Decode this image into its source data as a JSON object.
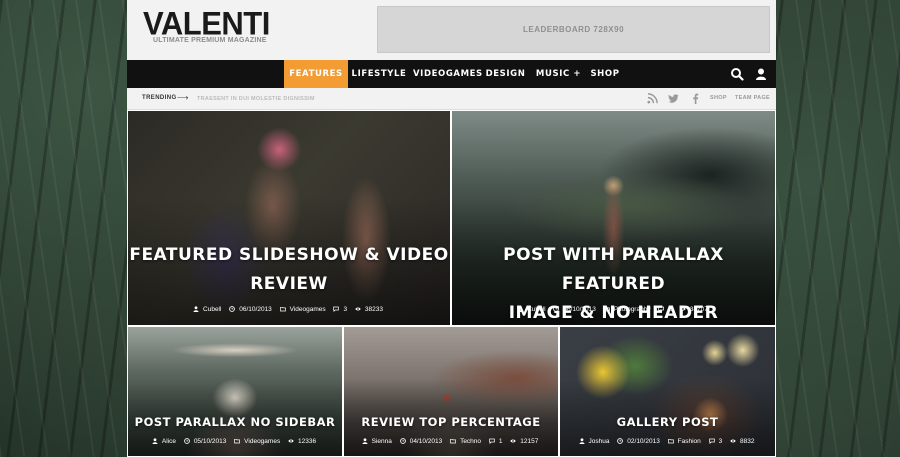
{
  "brand": {
    "logo": "VALENTI",
    "tagline": "ULTIMATE PREMIUM MAGAZINE",
    "leaderboard": "LEADERBOARD 728X90"
  },
  "nav": {
    "items": [
      {
        "label": "FEATURES +",
        "active": true
      },
      {
        "label": "LIFESTYLE +",
        "active": false
      },
      {
        "label": "VIDEOGAMES",
        "active": false
      },
      {
        "label": "DESIGN +",
        "active": false
      },
      {
        "label": "MUSIC +",
        "active": false
      },
      {
        "label": "SHOP +",
        "active": false
      }
    ],
    "icons": [
      "search-icon",
      "user-icon"
    ],
    "accent": "#f39c33"
  },
  "trending": {
    "label": "TRENDING",
    "headline": "TRAESENT IN DUI MOLESTIE DIGNISSIM",
    "links": [
      "SHOP",
      "TEAM PAGE"
    ],
    "social": [
      "rss-icon",
      "twitter-icon",
      "facebook-icon"
    ]
  },
  "posts": [
    {
      "title_line1": "FEATURED SLIDESHOW & VIDEO",
      "title_line2": "REVIEW",
      "author": "Cubell",
      "date": "06/10/2013",
      "category": "Videogames",
      "comments": "3",
      "views": "38233"
    },
    {
      "title_line1": "POST WITH PARALLAX FEATURED",
      "title_line2": "IMAGE & NO HEADER",
      "author": "Cubell",
      "date": "06/10/2013",
      "category": "Photography",
      "comments": "2",
      "views": "38707"
    },
    {
      "title": "POST PARALLAX NO SIDEBAR",
      "author": "Alice",
      "date": "05/10/2013",
      "category": "Videogames",
      "comments": "3",
      "views": "12336"
    },
    {
      "title": "REVIEW TOP PERCENTAGE",
      "author": "Sienna",
      "date": "04/10/2013",
      "category": "Techno",
      "comments": "1",
      "views": "12157"
    },
    {
      "title": "GALLERY POST",
      "author": "Joshua",
      "date": "02/10/2013",
      "category": "Fashion",
      "comments": "3",
      "views": "8832"
    }
  ]
}
